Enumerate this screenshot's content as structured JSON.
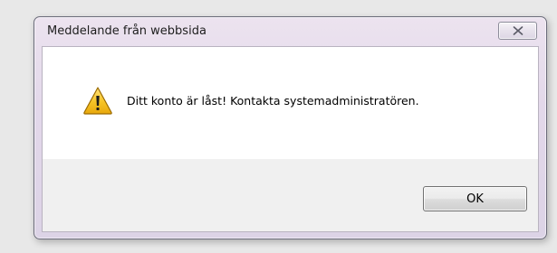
{
  "dialog": {
    "title": "Meddelande från webbsida",
    "close_icon": "close-icon",
    "message": "Ditt konto är låst! Kontakta systemadministratören.",
    "message_icon": "warning-icon",
    "ok_label": "OK"
  },
  "colors": {
    "frame": "#e3d8ea",
    "content_bg": "#ffffff",
    "footer_bg": "#f0f0f0",
    "warning_fill": "#f4c52a",
    "warning_border": "#9a6a00"
  }
}
